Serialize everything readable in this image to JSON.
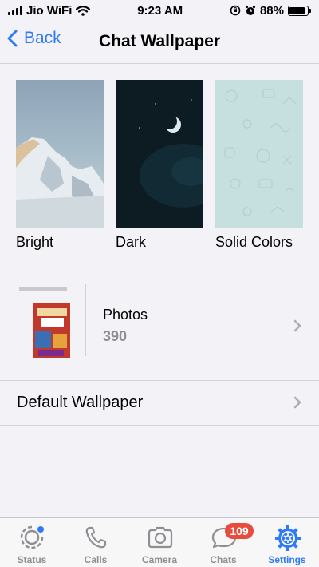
{
  "status_bar": {
    "carrier": "Jio WiFi",
    "time": "9:23 AM",
    "battery_percent": "88%",
    "battery_level": 0.88
  },
  "nav": {
    "back_label": "Back",
    "title": "Chat Wallpaper"
  },
  "wallpapers": [
    {
      "label": "Bright"
    },
    {
      "label": "Dark"
    },
    {
      "label": "Solid Colors"
    }
  ],
  "photos": {
    "title": "Photos",
    "count": "390"
  },
  "default_wallpaper": {
    "label": "Default Wallpaper"
  },
  "tabs": [
    {
      "label": "Status",
      "icon": "status-icon",
      "active": false
    },
    {
      "label": "Calls",
      "icon": "phone-icon",
      "active": false
    },
    {
      "label": "Camera",
      "icon": "camera-icon",
      "active": false
    },
    {
      "label": "Chats",
      "icon": "chat-bubble-icon",
      "active": false,
      "badge": "109"
    },
    {
      "label": "Settings",
      "icon": "gear-icon",
      "active": true
    }
  ],
  "colors": {
    "accent": "#2f7bf5",
    "badge": "#e74c3c",
    "background": "#f2f2f7"
  }
}
